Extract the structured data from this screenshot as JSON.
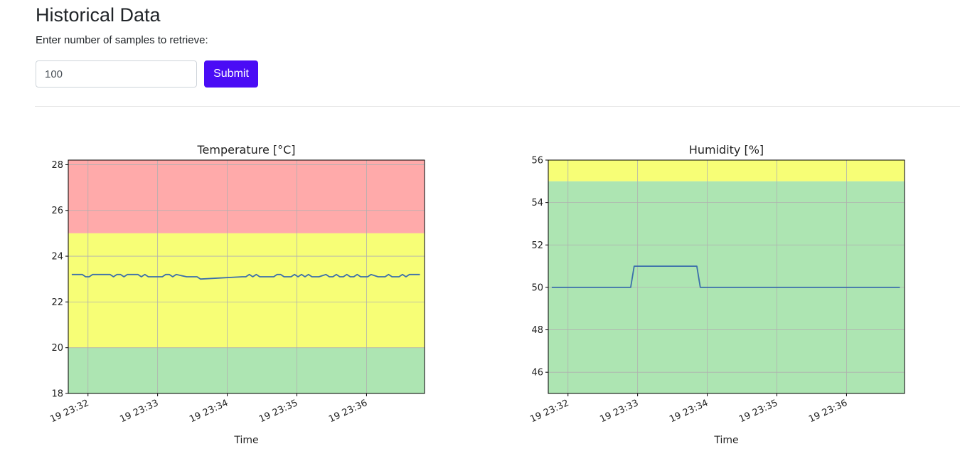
{
  "page": {
    "title": "Historical Data",
    "prompt": "Enter number of samples to retrieve:"
  },
  "form": {
    "samples_value": "100",
    "submit_label": "Submit"
  },
  "colors": {
    "accent": "#4a0cf5",
    "zone_red": "#ffaaaa",
    "zone_yellow": "#f7fe76",
    "zone_green": "#ade5b2",
    "line": "#3b6eab",
    "grid": "#b0b0b0"
  },
  "chart_data": [
    {
      "type": "line",
      "title": "Temperature [°C]",
      "xlabel": "Time",
      "ylabel": "",
      "ylim": [
        18,
        28.2
      ],
      "xlim": [
        "23:31:43",
        "23:36:50"
      ],
      "xticks": [
        "23:32",
        "23:33",
        "23:34",
        "23:35",
        "23:36"
      ],
      "xtick_labels": [
        "19 23:32",
        "19 23:33",
        "19 23:34",
        "19 23:35",
        "19 23:36"
      ],
      "yticks": [
        18,
        20,
        22,
        24,
        26,
        28
      ],
      "grid": true,
      "bands": [
        {
          "from": 25,
          "to": 28.2,
          "color": "#ffaaaa"
        },
        {
          "from": 20,
          "to": 25,
          "color": "#f7fe76"
        },
        {
          "from": 18,
          "to": 20,
          "color": "#ade5b2"
        }
      ],
      "series": [
        {
          "x": [
            "23:31:46",
            "23:31:55",
            "23:31:58",
            "23:32:01",
            "23:32:04",
            "23:32:07",
            "23:32:19",
            "23:32:22",
            "23:32:25",
            "23:32:28",
            "23:32:31",
            "23:32:34",
            "23:32:43",
            "23:32:46",
            "23:32:49",
            "23:32:52",
            "23:33:01",
            "23:33:04",
            "23:33:07",
            "23:33:10",
            "23:33:13",
            "23:33:16",
            "23:33:25",
            "23:33:28",
            "23:33:31",
            "23:33:34",
            "23:33:37",
            "23:34:13",
            "23:34:16",
            "23:34:19",
            "23:34:22",
            "23:34:25",
            "23:34:28",
            "23:34:37",
            "23:34:40",
            "23:34:43",
            "23:34:46",
            "23:34:49",
            "23:34:52",
            "23:34:55",
            "23:34:58",
            "23:35:01",
            "23:35:04",
            "23:35:07",
            "23:35:10",
            "23:35:13",
            "23:35:16",
            "23:35:19",
            "23:35:25",
            "23:35:28",
            "23:35:31",
            "23:35:34",
            "23:35:37",
            "23:35:40",
            "23:35:43",
            "23:35:46",
            "23:35:49",
            "23:35:52",
            "23:35:55",
            "23:35:58",
            "23:36:01",
            "23:36:04",
            "23:36:10",
            "23:36:13",
            "23:36:16",
            "23:36:19",
            "23:36:22",
            "23:36:25",
            "23:36:28",
            "23:36:31",
            "23:36:34",
            "23:36:37",
            "23:36:40",
            "23:36:46"
          ],
          "y": [
            23.2,
            23.2,
            23.1,
            23.1,
            23.2,
            23.2,
            23.2,
            23.1,
            23.2,
            23.2,
            23.1,
            23.2,
            23.2,
            23.1,
            23.2,
            23.1,
            23.1,
            23.1,
            23.2,
            23.2,
            23.1,
            23.2,
            23.1,
            23.1,
            23.1,
            23.1,
            23.0,
            23.1,
            23.1,
            23.2,
            23.1,
            23.2,
            23.1,
            23.1,
            23.1,
            23.2,
            23.2,
            23.1,
            23.1,
            23.1,
            23.2,
            23.1,
            23.2,
            23.1,
            23.2,
            23.1,
            23.1,
            23.1,
            23.2,
            23.1,
            23.1,
            23.2,
            23.1,
            23.1,
            23.2,
            23.1,
            23.1,
            23.2,
            23.1,
            23.1,
            23.1,
            23.2,
            23.1,
            23.1,
            23.1,
            23.2,
            23.1,
            23.1,
            23.1,
            23.2,
            23.1,
            23.2,
            23.2,
            23.2
          ]
        }
      ]
    },
    {
      "type": "line",
      "title": "Humidity [%]",
      "xlabel": "Time",
      "ylabel": "",
      "ylim": [
        45,
        56
      ],
      "xlim": [
        "23:31:43",
        "23:36:50"
      ],
      "xticks": [
        "23:32",
        "23:33",
        "23:34",
        "23:35",
        "23:36"
      ],
      "xtick_labels": [
        "19 23:32",
        "19 23:33",
        "19 23:34",
        "19 23:35",
        "19 23:36"
      ],
      "yticks": [
        46,
        48,
        50,
        52,
        54,
        56
      ],
      "grid": true,
      "bands": [
        {
          "from": 55,
          "to": 56,
          "color": "#f7fe76"
        },
        {
          "from": 45,
          "to": 55,
          "color": "#ade5b2"
        }
      ],
      "series": [
        {
          "x": [
            "23:31:46",
            "23:32:54",
            "23:32:57",
            "23:33:51",
            "23:33:54",
            "23:36:46"
          ],
          "y": [
            50,
            50,
            51,
            51,
            50,
            50
          ]
        }
      ]
    }
  ]
}
